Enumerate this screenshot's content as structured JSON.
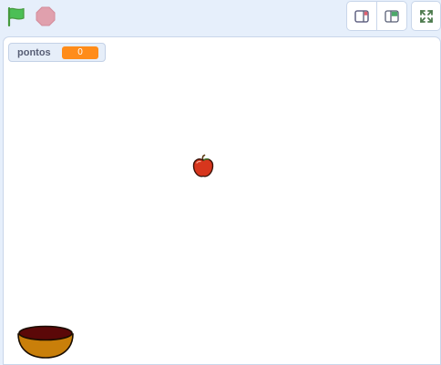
{
  "toolbar": {
    "green_flag_icon": "green-flag-icon",
    "stop_icon": "stop-icon",
    "small_stage_icon": "small-stage-icon",
    "large_stage_icon": "large-stage-icon",
    "fullscreen_icon": "fullscreen-icon"
  },
  "stage": {
    "monitor": {
      "label": "pontos",
      "value": "0"
    },
    "sprites": [
      "apple",
      "bowl"
    ]
  },
  "colors": {
    "background": "#e6effb",
    "flag": "#4cbf56",
    "stop": "#e0a0ad",
    "monitor_value": "#ff8c1a",
    "apple": "#d7361d",
    "bowl": "#c97f0a"
  }
}
